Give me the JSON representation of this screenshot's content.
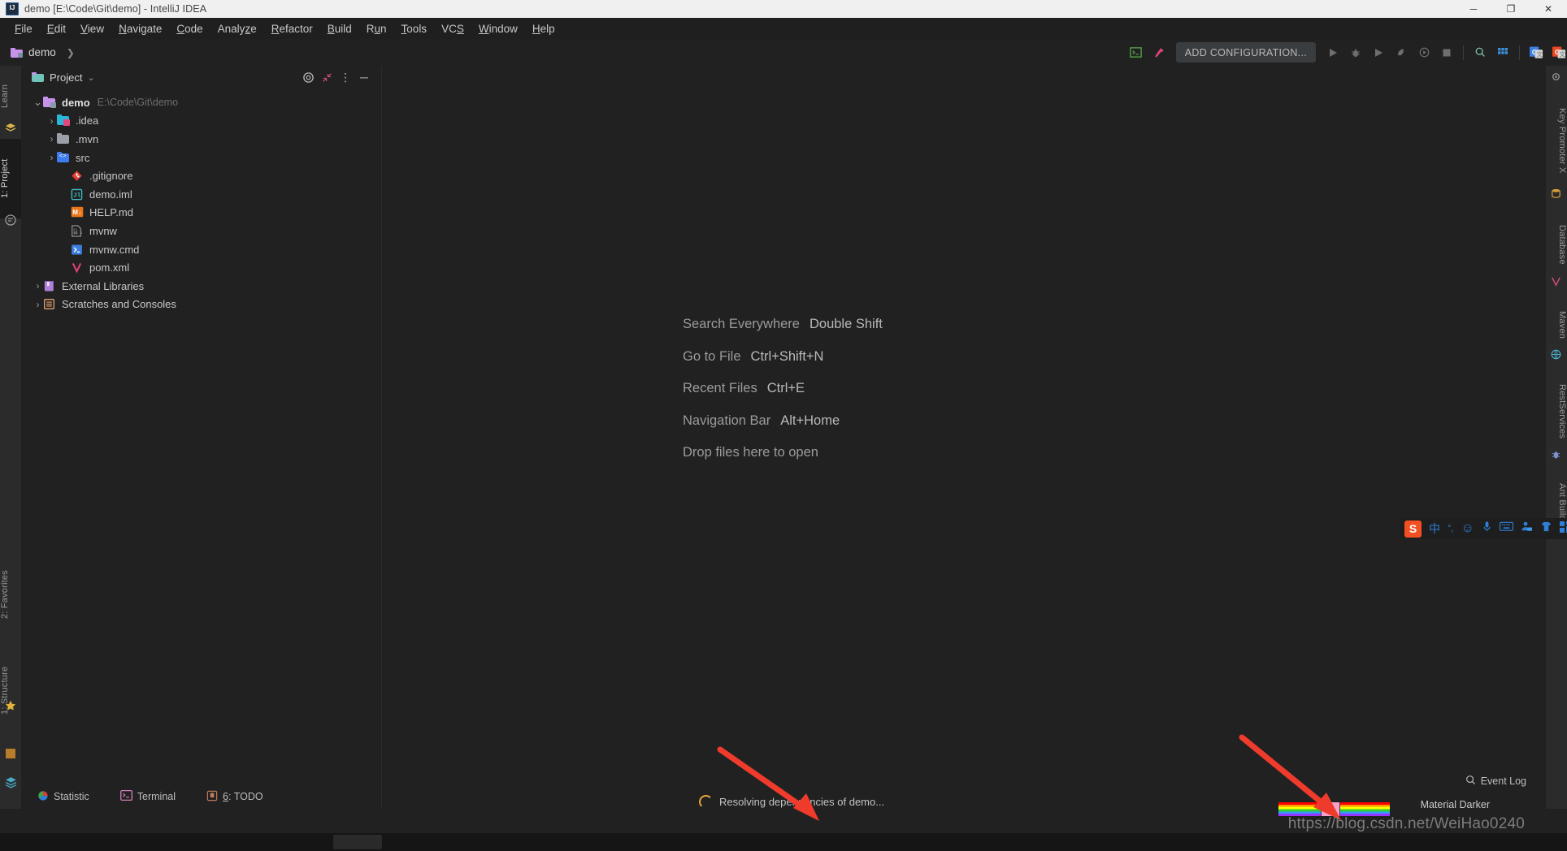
{
  "window": {
    "title": "demo [E:\\Code\\Git\\demo] - IntelliJ IDEA",
    "app_icon": "intellij-idea-icon",
    "minimize": "─",
    "maximize": "❐",
    "close": "✕"
  },
  "menubar": {
    "items": [
      {
        "label": "File",
        "mnemonic": "F"
      },
      {
        "label": "Edit",
        "mnemonic": "E"
      },
      {
        "label": "View",
        "mnemonic": "V"
      },
      {
        "label": "Navigate",
        "mnemonic": "N"
      },
      {
        "label": "Code",
        "mnemonic": "C"
      },
      {
        "label": "Analyze",
        "mnemonic": "z"
      },
      {
        "label": "Refactor",
        "mnemonic": "R"
      },
      {
        "label": "Build",
        "mnemonic": "B"
      },
      {
        "label": "Run",
        "mnemonic": "u"
      },
      {
        "label": "Tools",
        "mnemonic": "T"
      },
      {
        "label": "VCS",
        "mnemonic": "S"
      },
      {
        "label": "Window",
        "mnemonic": "W"
      },
      {
        "label": "Help",
        "mnemonic": "H"
      }
    ]
  },
  "navbar": {
    "breadcrumb": "demo",
    "breadcrumb_chevron": "❯",
    "run_config_label": "ADD CONFIGURATION...",
    "icons": {
      "terminal": "terminal-icon",
      "build": "build-hammer-icon",
      "run": "run-icon",
      "debug": "debug-icon",
      "run_coverage": "run-with-coverage-icon",
      "profile": "profiler-icon",
      "attach": "attach-process-icon",
      "stop": "stop-icon",
      "search": "search-everywhere-icon",
      "apps": "app-grid-icon",
      "translate_blue": "google-translate-icon",
      "translate_orange": "translate-plugin-icon"
    }
  },
  "left_strip": {
    "tabs": [
      {
        "label": "Learn",
        "active": false
      },
      {
        "label": "1: Project",
        "active": true
      },
      {
        "label": "2: Favorites",
        "active": false
      },
      {
        "label": "1: Structure",
        "active": false
      }
    ],
    "icons": [
      "learn-icon",
      "project-icon",
      "favorites-star-icon",
      "structure-icon",
      "layers-icon"
    ]
  },
  "right_strip": {
    "tabs": [
      {
        "label": "Key Promoter X"
      },
      {
        "label": "Database"
      },
      {
        "label": "Maven"
      },
      {
        "label": "RestServices"
      },
      {
        "label": "Ant Build"
      }
    ]
  },
  "project_panel": {
    "title": "Project",
    "title_chevron": "⌄",
    "actions": [
      {
        "name": "select-opened-file-icon",
        "glyph": "◎"
      },
      {
        "name": "collapse-all-icon",
        "glyph": "↖"
      },
      {
        "name": "options-menu-icon",
        "glyph": "⋮"
      },
      {
        "name": "hide-panel-icon",
        "glyph": "─"
      }
    ],
    "tree": [
      {
        "label": "demo",
        "path": "E:\\Code\\Git\\demo",
        "indent": 0,
        "arrow": "⌄",
        "icon": "module-folder-icon",
        "bold": true
      },
      {
        "label": ".idea",
        "path": "",
        "indent": 1,
        "arrow": "›",
        "icon": "idea-folder-icon",
        "bold": false
      },
      {
        "label": ".mvn",
        "path": "",
        "indent": 1,
        "arrow": "›",
        "icon": "folder-icon",
        "bold": false
      },
      {
        "label": "src",
        "path": "",
        "indent": 1,
        "arrow": "›",
        "icon": "source-folder-icon",
        "bold": false
      },
      {
        "label": ".gitignore",
        "path": "",
        "indent": 2,
        "arrow": "",
        "icon": "gitignore-file-icon",
        "bold": false
      },
      {
        "label": "demo.iml",
        "path": "",
        "indent": 2,
        "arrow": "",
        "icon": "iml-file-icon",
        "bold": false
      },
      {
        "label": "HELP.md",
        "path": "",
        "indent": 2,
        "arrow": "",
        "icon": "markdown-file-icon",
        "bold": false
      },
      {
        "label": "mvnw",
        "path": "",
        "indent": 2,
        "arrow": "",
        "icon": "binary-file-icon",
        "bold": false
      },
      {
        "label": "mvnw.cmd",
        "path": "",
        "indent": 2,
        "arrow": "",
        "icon": "cmd-file-icon",
        "bold": false
      },
      {
        "label": "pom.xml",
        "path": "",
        "indent": 2,
        "arrow": "",
        "icon": "maven-pom-icon",
        "bold": false
      },
      {
        "label": "External Libraries",
        "path": "",
        "indent": 0,
        "arrow": "›",
        "icon": "external-libraries-icon",
        "bold": false
      },
      {
        "label": "Scratches and Consoles",
        "path": "",
        "indent": 0,
        "arrow": "›",
        "icon": "scratches-icon",
        "bold": false
      }
    ]
  },
  "editor": {
    "hints": [
      {
        "action": "Search Everywhere",
        "shortcut": "Double Shift"
      },
      {
        "action": "Go to File",
        "shortcut": "Ctrl+Shift+N"
      },
      {
        "action": "Recent Files",
        "shortcut": "Ctrl+E"
      },
      {
        "action": "Navigation Bar",
        "shortcut": "Alt+Home"
      },
      {
        "action": "Drop files here to open",
        "shortcut": ""
      }
    ]
  },
  "status_bar": {
    "items": [
      {
        "label": "Statistic",
        "icon": "statistic-icon",
        "mnemonic": ""
      },
      {
        "label": "Terminal",
        "icon": "terminal-icon",
        "mnemonic": ""
      },
      {
        "label": "6: TODO",
        "icon": "todo-icon",
        "mnemonic": "6"
      }
    ],
    "progress_text": "Resolving dependencies of demo...",
    "progress_spinner": "loading-spinner-icon",
    "event_log": "Event Log",
    "event_log_icon": "event-log-icon",
    "theme_label": "Material Darker",
    "nyan_progress": "nyan-cat-progress-bar"
  },
  "ime": {
    "logo": "S",
    "items": [
      "中",
      "°,",
      "☺",
      "mic-icon",
      "keyboard-icon",
      "user-icon",
      "skin-icon",
      "apps-icon"
    ]
  },
  "watermark": "https://blog.csdn.net/WeiHao0240",
  "annotations": {
    "arrow1": "red-arrow-pointing-to-progress",
    "arrow2": "red-arrow-pointing-to-nyan-progress"
  },
  "colors": {
    "accent_pink": "#e4457a",
    "accent_green": "#4caf50",
    "background": "#212121",
    "panel": "#2b2b2b",
    "title_bar": "#f0f0f0"
  }
}
